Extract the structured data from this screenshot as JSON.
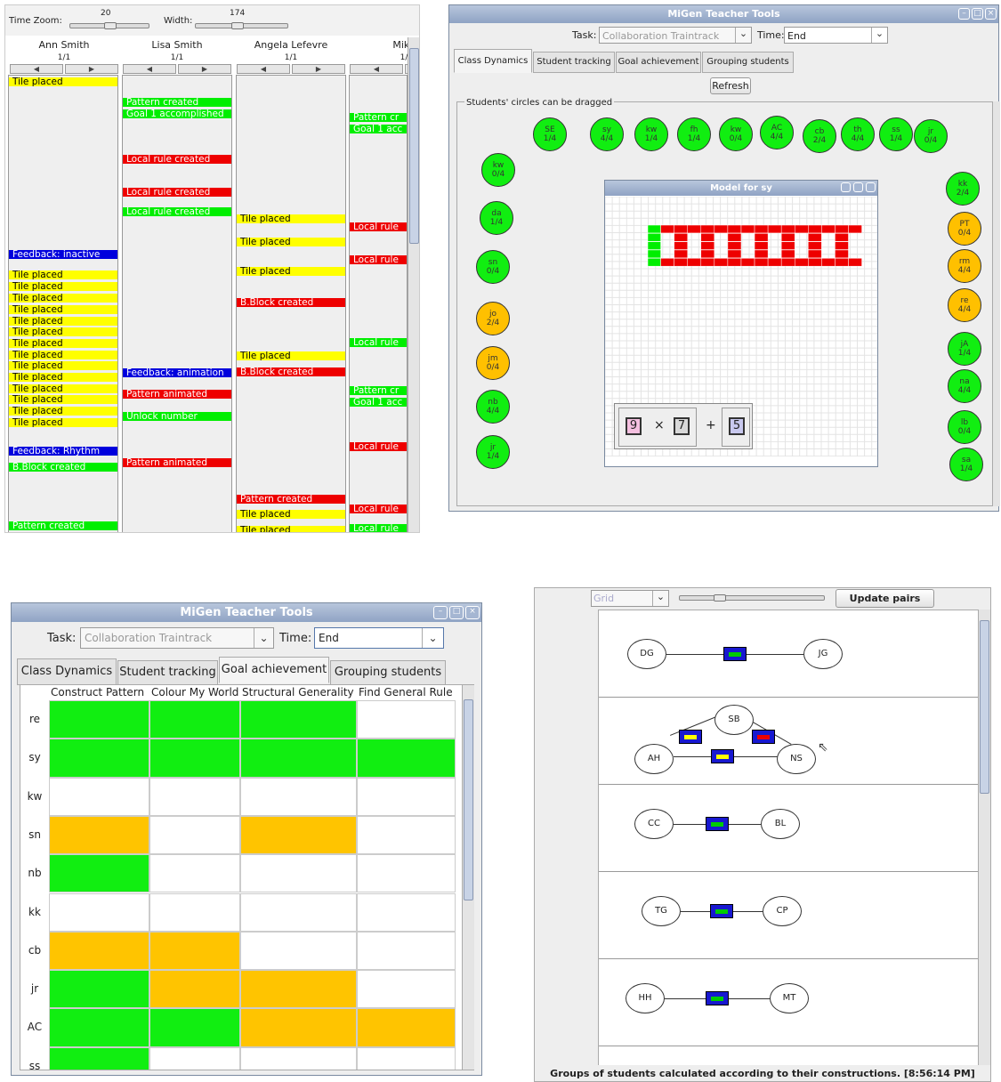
{
  "timeline": {
    "time_zoom_label": "Time Zoom:",
    "time_zoom_value": "20",
    "width_label": "Width:",
    "width_value": "174",
    "students": [
      {
        "name": "Ann Smith",
        "progress": "1/1"
      },
      {
        "name": "Lisa Smith",
        "progress": "1/1"
      },
      {
        "name": "Angela Lefevre",
        "progress": "1/1"
      },
      {
        "name": "Mike",
        "progress": "1/"
      }
    ],
    "col1": [
      "Tile placed",
      "Feedback: inactive",
      "Tile placed",
      "Tile placed",
      "Tile placed",
      "Tile placed",
      "Tile placed",
      "Tile placed",
      "Tile placed",
      "Tile placed",
      "Tile placed",
      "Tile placed",
      "Tile placed",
      "Tile placed",
      "Tile placed",
      "Tile placed",
      "Feedback: Rhythm",
      "B.Block created",
      "Pattern created"
    ],
    "col2": [
      "Pattern created",
      "Goal 1 accomplished",
      "Local rule created",
      "Local rule created",
      "Local rule created",
      "Feedback: animation",
      "Pattern animated",
      "Unlock number",
      "Pattern animated"
    ],
    "col3": [
      "Tile placed",
      "Tile placed",
      "Tile placed",
      "B.Block created",
      "Tile placed",
      "B.Block created",
      "Pattern created",
      "Tile placed",
      "Tile placed"
    ],
    "col4": [
      "Pattern cr",
      "Goal 1 acc",
      "Local rule",
      "Local rule",
      "Local rule",
      "Pattern cr",
      "Goal 1 acc",
      "Local rule",
      "Local rule",
      "Local rule"
    ]
  },
  "tools1": {
    "title": "MiGen Teacher Tools",
    "task_label": "Task:",
    "task_value": "Collaboration Traintrack",
    "time_label": "Time:",
    "time_value": "End",
    "tabs": [
      "Class Dynamics",
      "Student tracking",
      "Goal achievement",
      "Grouping students"
    ],
    "refresh": "Refresh",
    "hint": "Students' circles can be dragged",
    "circles": [
      {
        "id": "SE",
        "v": "1/4",
        "c": "g"
      },
      {
        "id": "sy",
        "v": "4/4",
        "c": "g"
      },
      {
        "id": "kw",
        "v": "1/4",
        "c": "g"
      },
      {
        "id": "fh",
        "v": "1/4",
        "c": "g"
      },
      {
        "id": "kw",
        "v": "0/4",
        "c": "g"
      },
      {
        "id": "AC",
        "v": "4/4",
        "c": "g"
      },
      {
        "id": "cb",
        "v": "2/4",
        "c": "g"
      },
      {
        "id": "th",
        "v": "4/4",
        "c": "g"
      },
      {
        "id": "ss",
        "v": "1/4",
        "c": "g"
      },
      {
        "id": "jr",
        "v": "0/4",
        "c": "g"
      },
      {
        "id": "kw",
        "v": "0/4",
        "c": "g"
      },
      {
        "id": "da",
        "v": "1/4",
        "c": "g"
      },
      {
        "id": "sn",
        "v": "0/4",
        "c": "g"
      },
      {
        "id": "jo",
        "v": "2/4",
        "c": "o"
      },
      {
        "id": "jm",
        "v": "0/4",
        "c": "o"
      },
      {
        "id": "nb",
        "v": "4/4",
        "c": "g"
      },
      {
        "id": "jr",
        "v": "1/4",
        "c": "g"
      },
      {
        "id": "kk",
        "v": "2/4",
        "c": "g"
      },
      {
        "id": "PT",
        "v": "0/4",
        "c": "o"
      },
      {
        "id": "rm",
        "v": "4/4",
        "c": "o"
      },
      {
        "id": "re",
        "v": "4/4",
        "c": "o"
      },
      {
        "id": "jA",
        "v": "1/4",
        "c": "g"
      },
      {
        "id": "na",
        "v": "4/4",
        "c": "g"
      },
      {
        "id": "lb",
        "v": "0/4",
        "c": "g"
      },
      {
        "id": "sa",
        "v": "1/4",
        "c": "g"
      }
    ],
    "model_title": "Model for sy",
    "rule": {
      "a": "9",
      "op1": "×",
      "b": "7",
      "op2": "+",
      "c": "5"
    }
  },
  "tools2": {
    "title": "MiGen Teacher Tools",
    "task_label": "Task:",
    "task_value": "Collaboration Traintrack",
    "time_label": "Time:",
    "time_value": "End",
    "tabs": [
      "Class Dynamics",
      "Student tracking",
      "Goal achievement",
      "Grouping students"
    ],
    "columns": [
      "Construct Pattern",
      "Colour My World",
      "Structural Generality",
      "Find General Rule"
    ],
    "rows": [
      {
        "id": "re",
        "cells": [
          "g",
          "g",
          "g",
          "w"
        ]
      },
      {
        "id": "sy",
        "cells": [
          "g",
          "g",
          "g",
          "g"
        ]
      },
      {
        "id": "kw",
        "cells": [
          "w",
          "w",
          "w",
          "w"
        ]
      },
      {
        "id": "sn",
        "cells": [
          "o",
          "w",
          "o",
          "w"
        ]
      },
      {
        "id": "nb",
        "cells": [
          "g",
          "w",
          "w",
          "w"
        ]
      },
      {
        "id": "kk",
        "cells": [
          "w",
          "w",
          "w",
          "w"
        ]
      },
      {
        "id": "cb",
        "cells": [
          "o",
          "o",
          "w",
          "w"
        ]
      },
      {
        "id": "jr",
        "cells": [
          "g",
          "o",
          "o",
          "w"
        ]
      },
      {
        "id": "AC",
        "cells": [
          "g",
          "g",
          "o",
          "o"
        ]
      },
      {
        "id": "ss",
        "cells": [
          "g",
          "w",
          "w",
          "w"
        ]
      }
    ]
  },
  "pairs": {
    "view": "Grid",
    "update_label": "Update pairs",
    "groups": [
      [
        "DG",
        "JG"
      ],
      [
        "SB",
        "AH",
        "NS"
      ],
      [
        "CC",
        "BL"
      ],
      [
        "TG",
        "CP"
      ],
      [
        "HH",
        "MT"
      ]
    ],
    "status": "Groups of students calculated according to their constructions. [8:56:14 PM]",
    "colors": {
      "blue": "#1818d0",
      "green": "#00cc00",
      "yellow": "#ffff00",
      "red": "#ee0000"
    }
  }
}
